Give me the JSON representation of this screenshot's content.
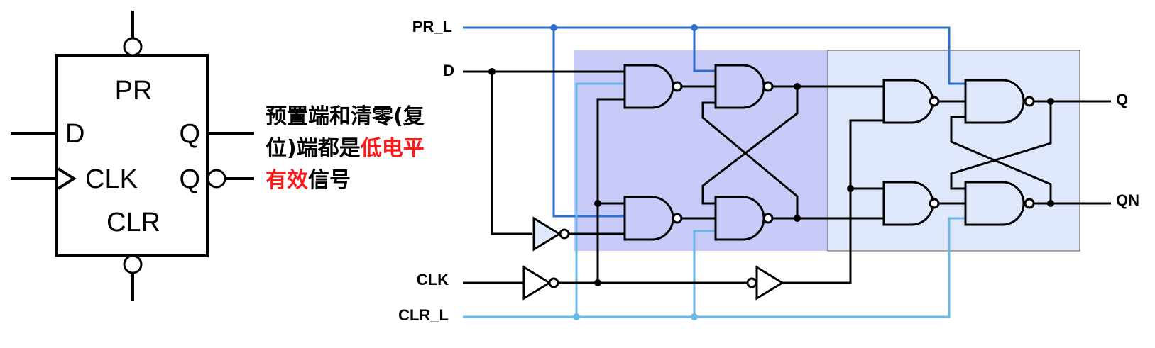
{
  "symbol": {
    "pin_pr": "PR",
    "pin_d": "D",
    "pin_clk": "CLK",
    "pin_q": "Q",
    "pin_qn": "Q",
    "pin_clr": "CLR"
  },
  "note": {
    "line1": "预置端和清零(复",
    "line2": "位)端都是",
    "line2_red": "低电平",
    "line3_red": "有效",
    "line3": "信号"
  },
  "signals": {
    "pr_l": "PR_L",
    "d": "D",
    "clk": "CLK",
    "clr_l": "CLR_L",
    "q": "Q",
    "qn": "QN"
  },
  "colors": {
    "master_fill": "#c8cbf7",
    "slave_fill": "#dfe8fb",
    "pr_wire": "#2f6fd0",
    "clr_wire": "#6ab8e8",
    "emphasis": "#ff1a1a"
  }
}
